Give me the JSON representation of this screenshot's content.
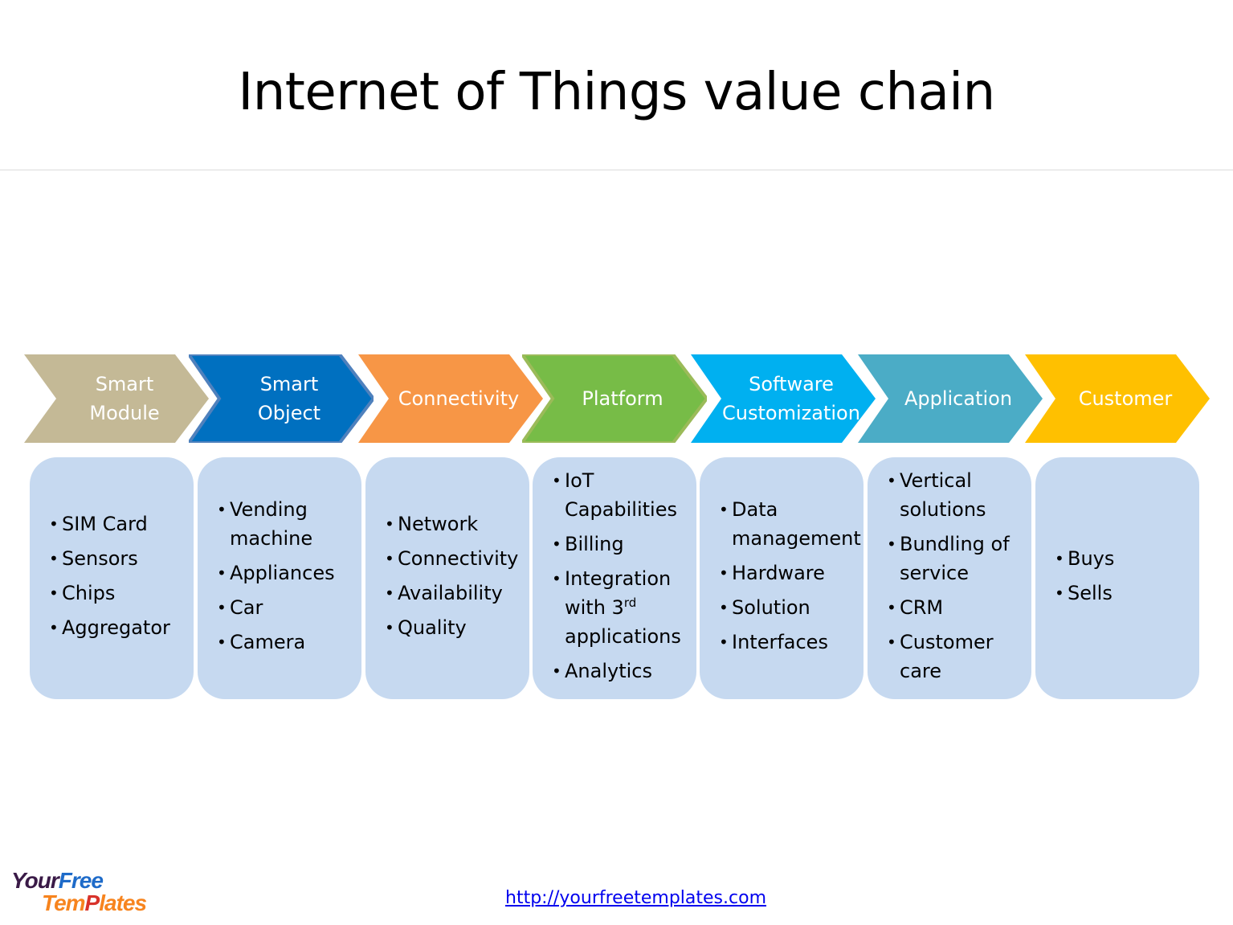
{
  "title": "Internet of Things value chain",
  "colors": {
    "stage_fills": [
      "#c4b996",
      "#0070c0",
      "#f79646",
      "#77bc47",
      "#00b0f0",
      "#4bacc6",
      "#ffc000"
    ],
    "stage_borders": [
      null,
      "#4f81bd",
      null,
      "#9bbb59",
      null,
      null,
      null
    ],
    "box_fill": "#c6d9f0"
  },
  "stages": [
    {
      "label": "Smart\nModule",
      "items": [
        "SIM Card",
        "Sensors",
        "Chips",
        "Aggregator"
      ]
    },
    {
      "label": "Smart\nObject",
      "items": [
        "Vending machine",
        "Appliances",
        "Car",
        "Camera"
      ]
    },
    {
      "label": "Connectivity",
      "items": [
        "Network",
        "Connectivity",
        "Availability",
        "Quality"
      ]
    },
    {
      "label": "Platform",
      "items": [
        "IoT Capabilities",
        "Billing",
        "Integration with 3rd applications",
        "Analytics"
      ]
    },
    {
      "label": "Software\nCustomization",
      "items": [
        "Data management",
        "Hardware",
        "Solution",
        "Interfaces"
      ]
    },
    {
      "label": "Application",
      "items": [
        "Vertical solutions",
        "Bundling of service",
        "CRM",
        "Customer care"
      ]
    },
    {
      "label": "Customer",
      "items": [
        "Buys",
        "Sells"
      ]
    }
  ],
  "footer": {
    "logo_line1_a": "Your",
    "logo_line1_b": "Free",
    "logo_line2_a": "Tem",
    "logo_line2_p": "P",
    "logo_line2_b": "lates",
    "link": "http://yourfreetemplates.com"
  }
}
